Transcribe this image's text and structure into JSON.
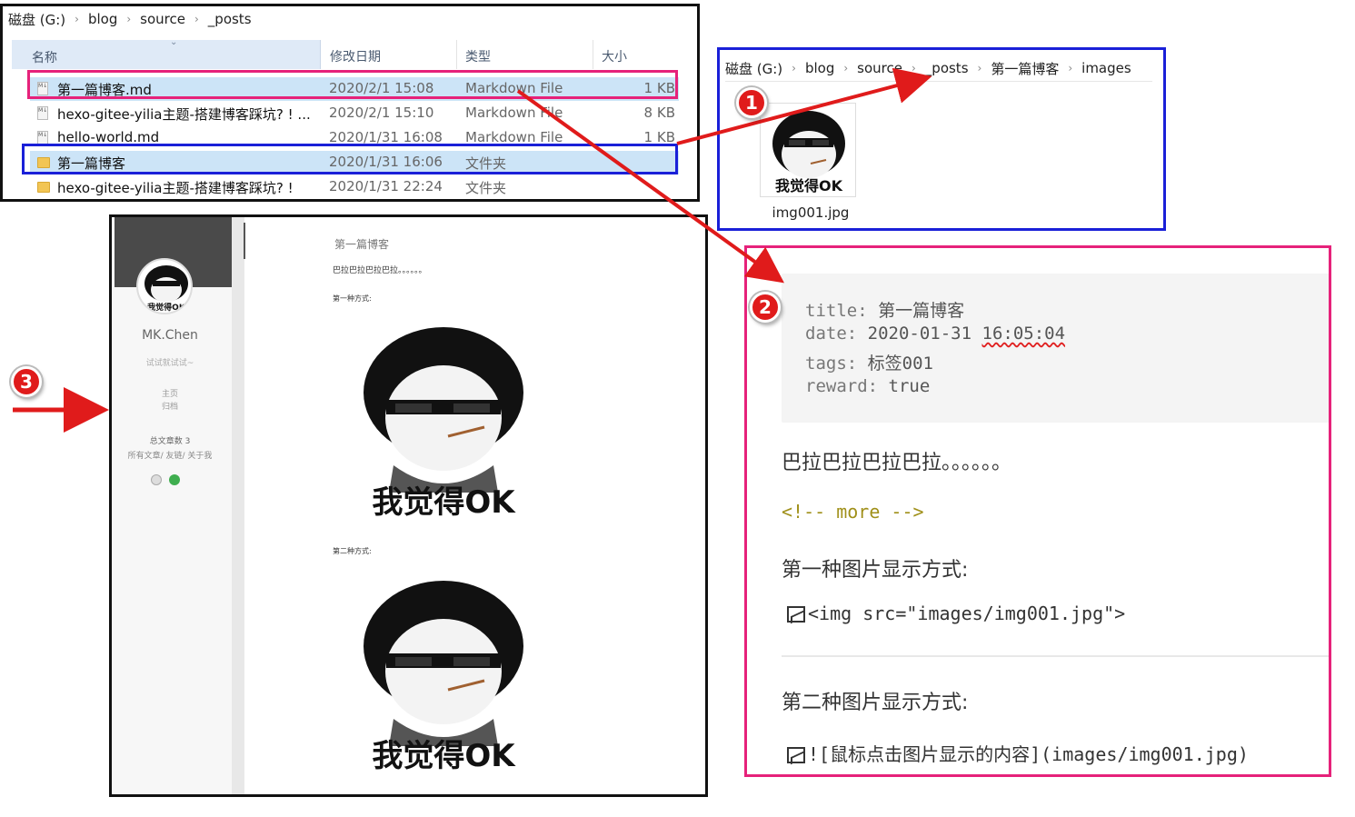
{
  "explorer": {
    "breadcrumb": [
      "磁盘 (G:)",
      "blog",
      "source",
      "_posts"
    ],
    "columns": {
      "name": "名称",
      "date": "修改日期",
      "type": "类型",
      "size": "大小"
    },
    "files": [
      {
        "name": "第一篇博客.md",
        "date": "2020/2/1 15:08",
        "type": "Markdown File",
        "size": "1 KB",
        "kind": "md"
      },
      {
        "name": "hexo-gitee-yilia主题-搭建博客踩坑? ! ...",
        "date": "2020/2/1 15:10",
        "type": "Markdown File",
        "size": "8 KB",
        "kind": "md"
      },
      {
        "name": "hello-world.md",
        "date": "2020/1/31 16:08",
        "type": "Markdown File",
        "size": "1 KB",
        "kind": "md"
      },
      {
        "name": "第一篇博客",
        "date": "2020/1/31 16:06",
        "type": "文件夹",
        "size": "",
        "kind": "folder"
      },
      {
        "name": "hexo-gitee-yilia主题-搭建博客踩坑? !",
        "date": "2020/1/31 22:24",
        "type": "文件夹",
        "size": "",
        "kind": "folder"
      }
    ]
  },
  "images_folder": {
    "breadcrumb": [
      "磁盘 (G:)",
      "blog",
      "source",
      "_posts",
      "第一篇博客",
      "images"
    ],
    "file_name": "img001.jpg",
    "thumb_text": "我觉得OK"
  },
  "blog": {
    "author": "MK.Chen",
    "tagline": "试试就试试~",
    "nav": [
      "主页",
      "归档"
    ],
    "post_count": "总文章数 3",
    "links": "所有文章/ 友链/ 关于我",
    "avatar_text": "我觉得OK",
    "post_title": "第一篇博客",
    "intro": "巴拉巴拉巴拉巴拉。。。。。。",
    "method1": "第一种方式:",
    "method2": "第二种方式:",
    "meme_text": "我觉得OK"
  },
  "markdown": {
    "front_matter": {
      "title_key": "title:",
      "title_val": "第一篇博客",
      "date_key": "date:",
      "date_val": "2020-01-31",
      "date_time": "16:05:04",
      "tags_key": "tags:",
      "tags_val": "标签001",
      "reward_key": "reward:",
      "reward_val": "true"
    },
    "body_text": "巴拉巴拉巴拉巴拉。。。。。。",
    "more_comment": "<!-- more -->",
    "method1_heading": "第一种图片显示方式:",
    "method1_code": "<img src=\"images/img001.jpg\">",
    "method2_heading": "第二种图片显示方式:",
    "method2_code": "![鼠标点击图片显示的内容](images/img001.jpg)"
  },
  "badges": [
    "1",
    "2",
    "3"
  ],
  "colors": {
    "pink_highlight": "#e6227a",
    "blue_highlight": "#1a20d8",
    "arrow_red": "#e01b1b",
    "selection_blue": "#cce4f7"
  }
}
